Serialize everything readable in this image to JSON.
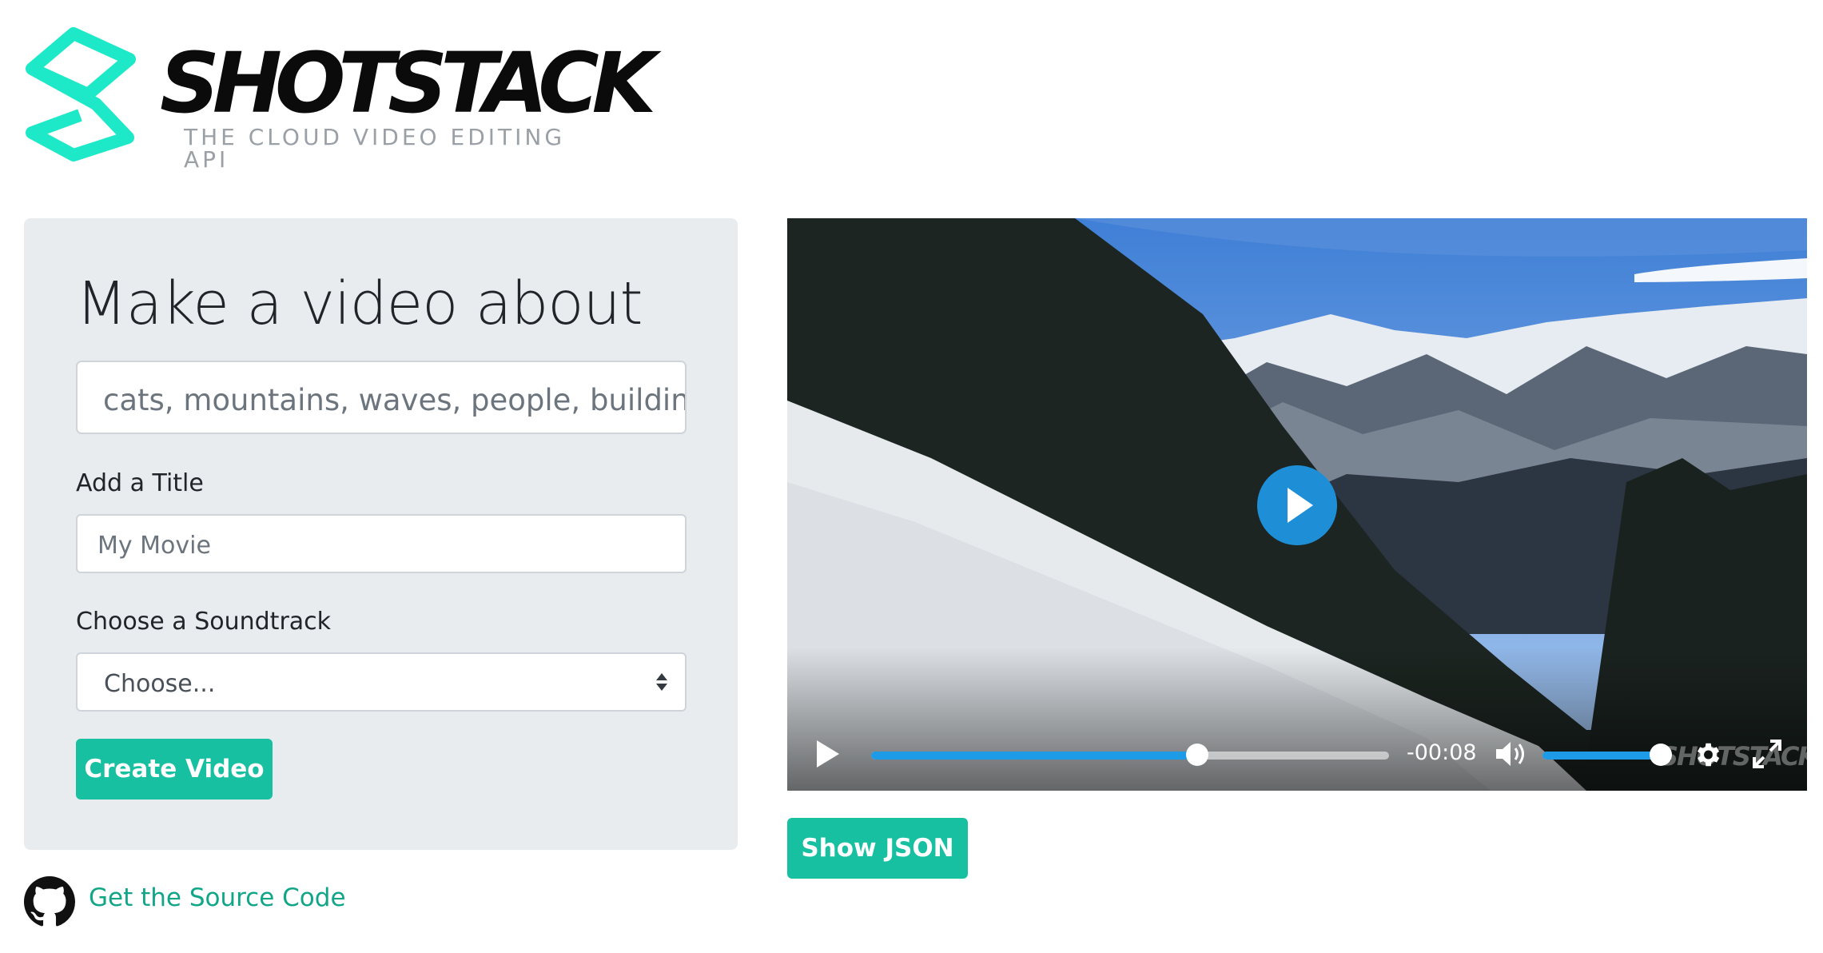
{
  "brand": {
    "name": "SHOTSTACK",
    "tagline": "THE CLOUD VIDEO EDITING API",
    "accent_color": "#17c0a0",
    "logo_icon": "shotstack-logo-icon"
  },
  "form": {
    "heading": "Make a video about",
    "search": {
      "placeholder": "cats, mountains, waves, people, building"
    },
    "title_field": {
      "label": "Add a Title",
      "placeholder": "My Movie"
    },
    "soundtrack": {
      "label": "Choose a Soundtrack",
      "selected": "Choose..."
    },
    "create_button": "Create Video"
  },
  "source_link": {
    "text": "Get the Source Code",
    "icon": "github-icon"
  },
  "player": {
    "time_remaining": "-00:08",
    "progress": 0.63,
    "volume": 1.0,
    "watermark": "SHOTSTACK"
  },
  "show_json_button": "Show JSON"
}
